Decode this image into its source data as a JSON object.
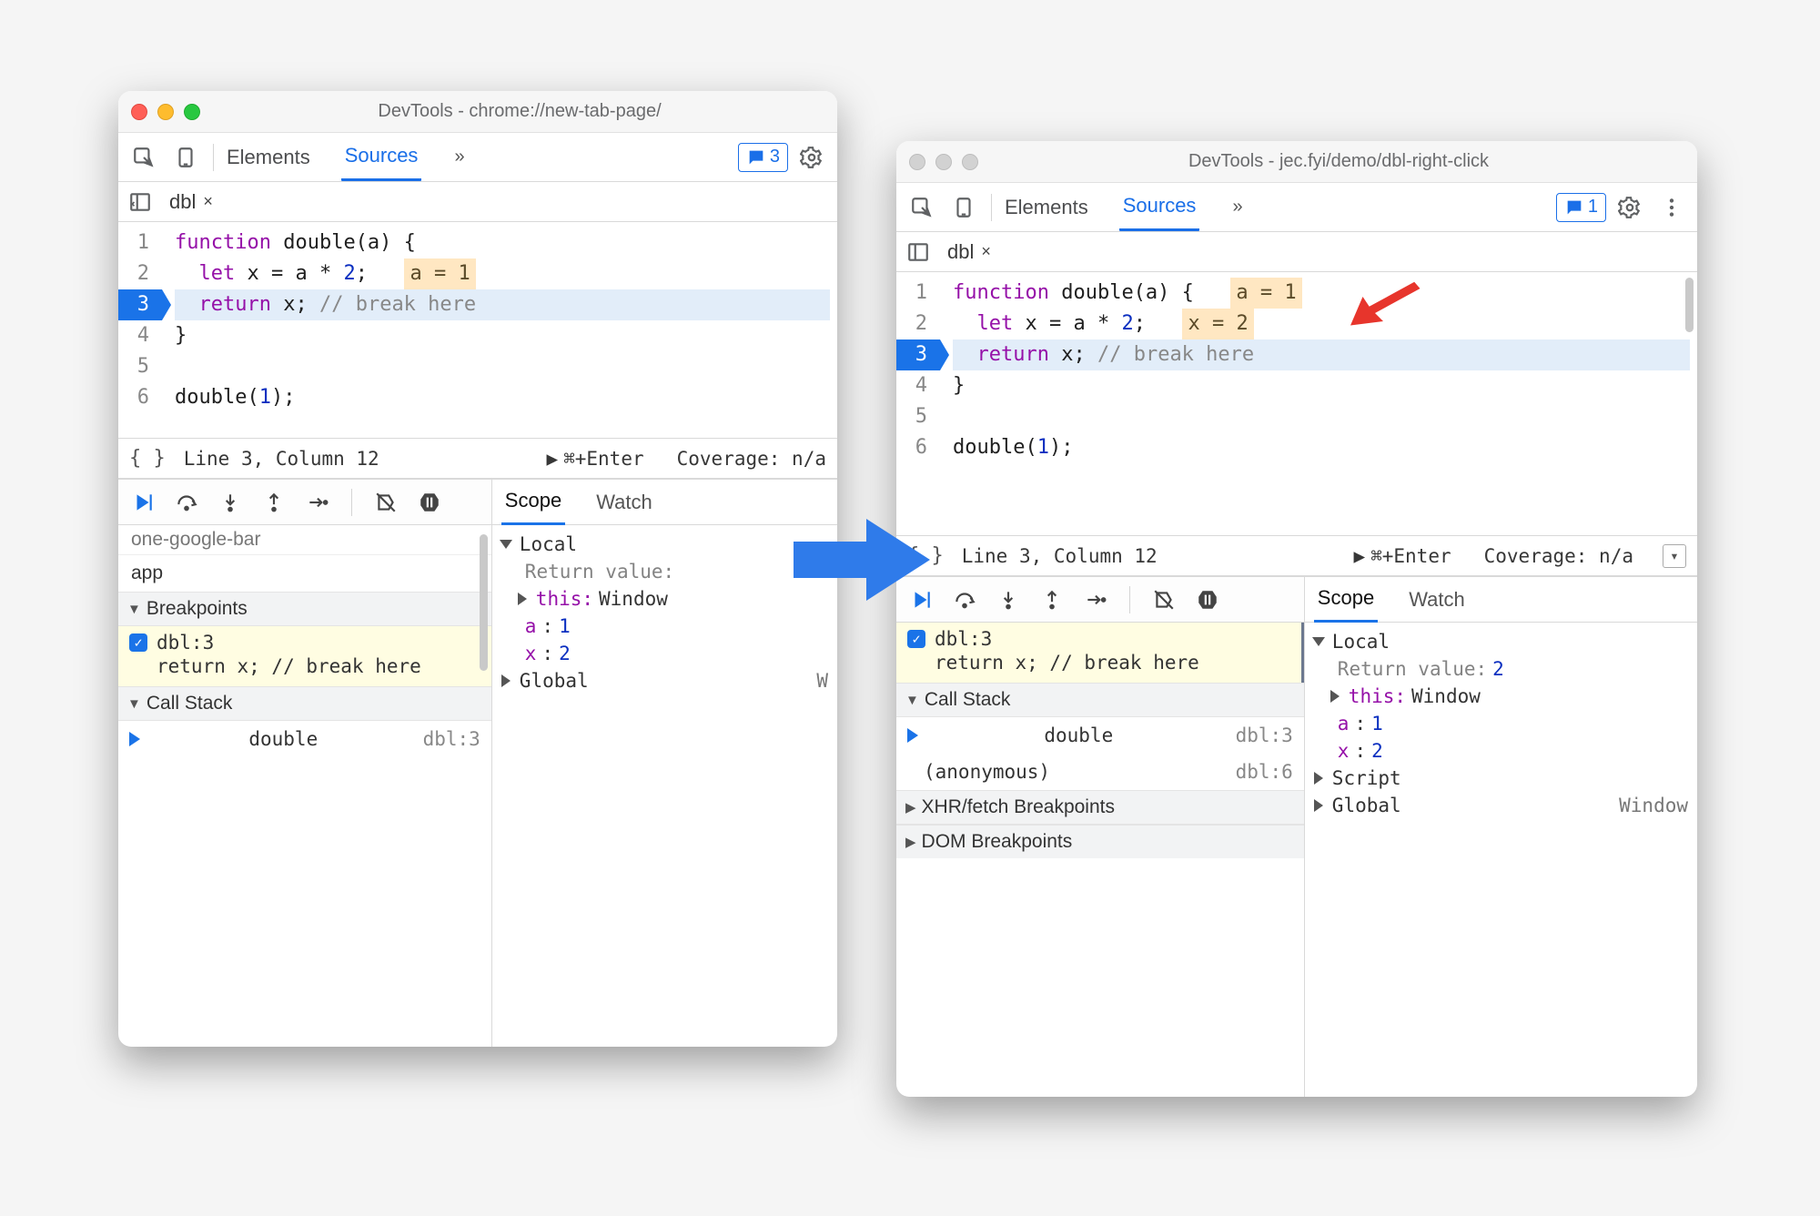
{
  "arrow_color": "#2F7BEA",
  "red_arrow_color": "#E7352C",
  "window1": {
    "title": "DevTools - chrome://new-tab-page/",
    "traffic_active": true,
    "tabs": {
      "elements": "Elements",
      "sources": "Sources"
    },
    "issues_count": "3",
    "file_tab": "dbl",
    "code": {
      "lines": [
        "function double(a) {",
        "  let x = a * 2;",
        "  return x; // break here",
        "}",
        "",
        "double(1);"
      ],
      "inline_values": {
        "1": "a = 1"
      },
      "breakpoint_line": 3,
      "highlight_line": 3
    },
    "status": {
      "pos": "Line 3, Column 12",
      "hint": "⌘+Enter",
      "coverage": "Coverage: n/a"
    },
    "left_pane": {
      "clipped_row": "one-google-bar",
      "row_app": "app",
      "breakpoints_title": "Breakpoints",
      "bp_label": "dbl:3",
      "bp_code": "return x; // break here",
      "callstack_title": "Call Stack",
      "stack": [
        {
          "name": "double",
          "loc": "dbl:3",
          "active": true
        }
      ]
    },
    "scope": {
      "tabs": {
        "scope": "Scope",
        "watch": "Watch"
      },
      "local_label": "Local",
      "return_label": "Return value:",
      "this_label": "this:",
      "this_value": "Window",
      "vars": [
        {
          "k": "a",
          "v": "1"
        },
        {
          "k": "x",
          "v": "2"
        }
      ],
      "global_label": "Global",
      "global_value": "W"
    }
  },
  "window2": {
    "title": "DevTools - jec.fyi/demo/dbl-right-click",
    "traffic_active": false,
    "tabs": {
      "elements": "Elements",
      "sources": "Sources"
    },
    "issues_count": "1",
    "file_tab": "dbl",
    "code": {
      "lines": [
        "function double(a) {",
        "  let x = a * 2;",
        "  return x; // break here",
        "}",
        "",
        "double(1);"
      ],
      "inline_values": {
        "0": "a = 1",
        "1": "x = 2"
      },
      "breakpoint_line": 3,
      "highlight_line": 3
    },
    "status": {
      "pos": "Line 3, Column 12",
      "hint": "⌘+Enter",
      "coverage": "Coverage: n/a"
    },
    "left_pane": {
      "bp_label": "dbl:3",
      "bp_code": "return x; // break here",
      "callstack_title": "Call Stack",
      "stack": [
        {
          "name": "double",
          "loc": "dbl:3",
          "active": true
        },
        {
          "name": "(anonymous)",
          "loc": "dbl:6",
          "active": false
        }
      ],
      "xhr_title": "XHR/fetch Breakpoints",
      "dom_title": "DOM Breakpoints"
    },
    "scope": {
      "tabs": {
        "scope": "Scope",
        "watch": "Watch"
      },
      "local_label": "Local",
      "return_label": "Return value:",
      "return_value": "2",
      "this_label": "this:",
      "this_value": "Window",
      "vars": [
        {
          "k": "a",
          "v": "1"
        },
        {
          "k": "x",
          "v": "2"
        }
      ],
      "script_label": "Script",
      "global_label": "Global",
      "global_value": "Window"
    }
  }
}
